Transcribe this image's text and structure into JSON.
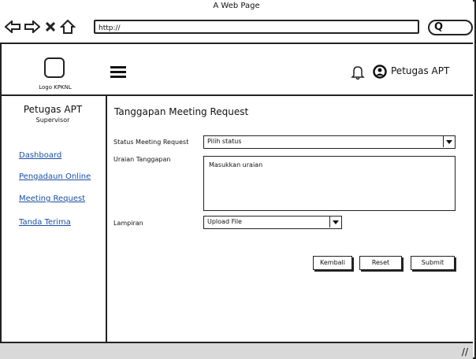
{
  "window": {
    "title": "A Web Page",
    "url": "http://"
  },
  "header": {
    "logo_label": "Logo KPKNL",
    "user_name": "Petugas APT"
  },
  "sidebar": {
    "role": "Petugas APT",
    "subrole": "Supervisor",
    "items": [
      {
        "label": "Dashboard"
      },
      {
        "label": "Pengadaun Online"
      },
      {
        "label": "Meeting Request"
      },
      {
        "label": "Tanda Terima"
      }
    ]
  },
  "form": {
    "title": "Tanggapan Meeting Request",
    "status_label": "Status Meeting Request",
    "status_value": "Pilih status",
    "uraian_label": "Uraian Tanggapan",
    "uraian_placeholder": "Masukkan uraian",
    "lampiran_label": "Lampiran",
    "lampiran_value": "Upload File"
  },
  "buttons": {
    "back": "Kembali",
    "reset": "Reset",
    "submit": "Submit"
  }
}
